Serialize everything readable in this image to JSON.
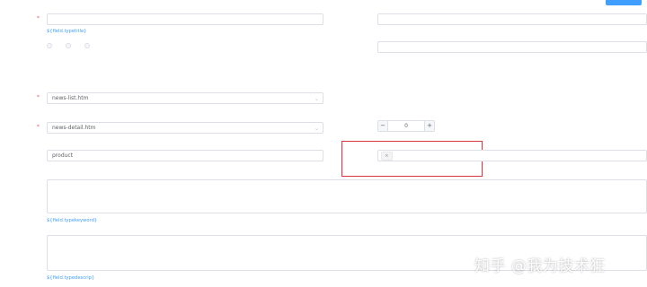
{
  "topbar": {
    "button_label": ""
  },
  "left": {
    "name": {
      "label": "",
      "value": "",
      "hint_prefix": "",
      "hint_code": "${field.typetitle}",
      "hint_suffix": ""
    },
    "type": {
      "label": "",
      "options": [
        "",
        "",
        ""
      ],
      "desc": [
        "",
        "",
        "",
        ""
      ]
    },
    "list_tpl": {
      "label": "",
      "value": "news-list.htm",
      "hint": ""
    },
    "detail_tpl": {
      "label": "",
      "value": "news-detail.htm",
      "hint": ""
    },
    "path": {
      "label": "",
      "value": "product",
      "hint": ""
    }
  },
  "right": {
    "parent": {
      "label": "",
      "value": "",
      "hint": ""
    },
    "model": {
      "label": "",
      "placeholder": "",
      "desc": [
        "",
        ""
      ]
    },
    "order": {
      "label": "",
      "value": "0",
      "minus": "−",
      "plus": "+"
    },
    "attr": {
      "label": "",
      "tag": "",
      "tag_close": "×",
      "hint": ""
    }
  },
  "keywords": {
    "label": "",
    "placeholder": "",
    "hint_prefix": "",
    "hint_code": "${field.typekeyword}",
    "hint_suffix": ""
  },
  "description": {
    "label": "",
    "placeholder": "",
    "hint_prefix": "",
    "hint_code": "${field.typedescrip}",
    "hint_suffix": ""
  },
  "watermark": "知乎 @我为技术狂",
  "colors": {
    "accent": "#409eff",
    "highlight": "#d9363e",
    "required": "#f56c6c"
  }
}
